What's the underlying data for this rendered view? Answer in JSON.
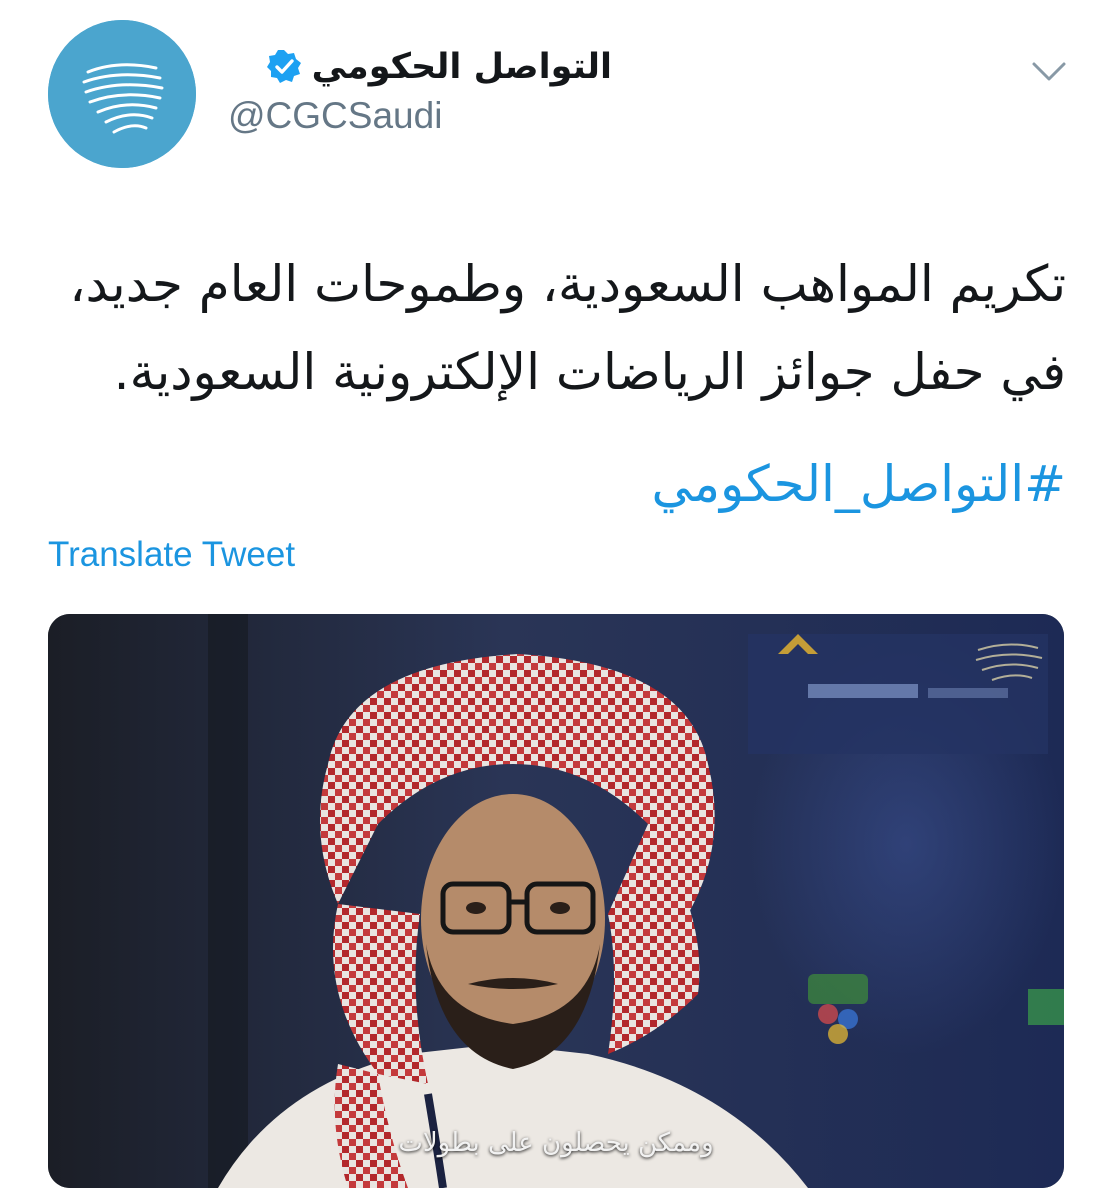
{
  "account": {
    "display_name": "التواصل الحكومي",
    "handle": "@CGCSaudi",
    "avatar_icon": "cgc-logo-icon",
    "verified_icon": "verified-badge-icon",
    "avatar_color": "#4ba5ce"
  },
  "menu": {
    "icon": "chevron-down-icon"
  },
  "tweet": {
    "lines": [
      "تكريم المواهب السعودية، وطموحات العام جديد،",
      "في حفل جوائز الرياضات الإلكترونية السعودية."
    ],
    "hashtag": "#التواصل_الحكومي",
    "translate_label": "Translate Tweet"
  },
  "media": {
    "subtitle": "وممكن يحصلون على بطولات"
  },
  "colors": {
    "link": "#1b95e0",
    "text": "#14171a",
    "muted": "#657786",
    "verified": "#1da1f2"
  }
}
